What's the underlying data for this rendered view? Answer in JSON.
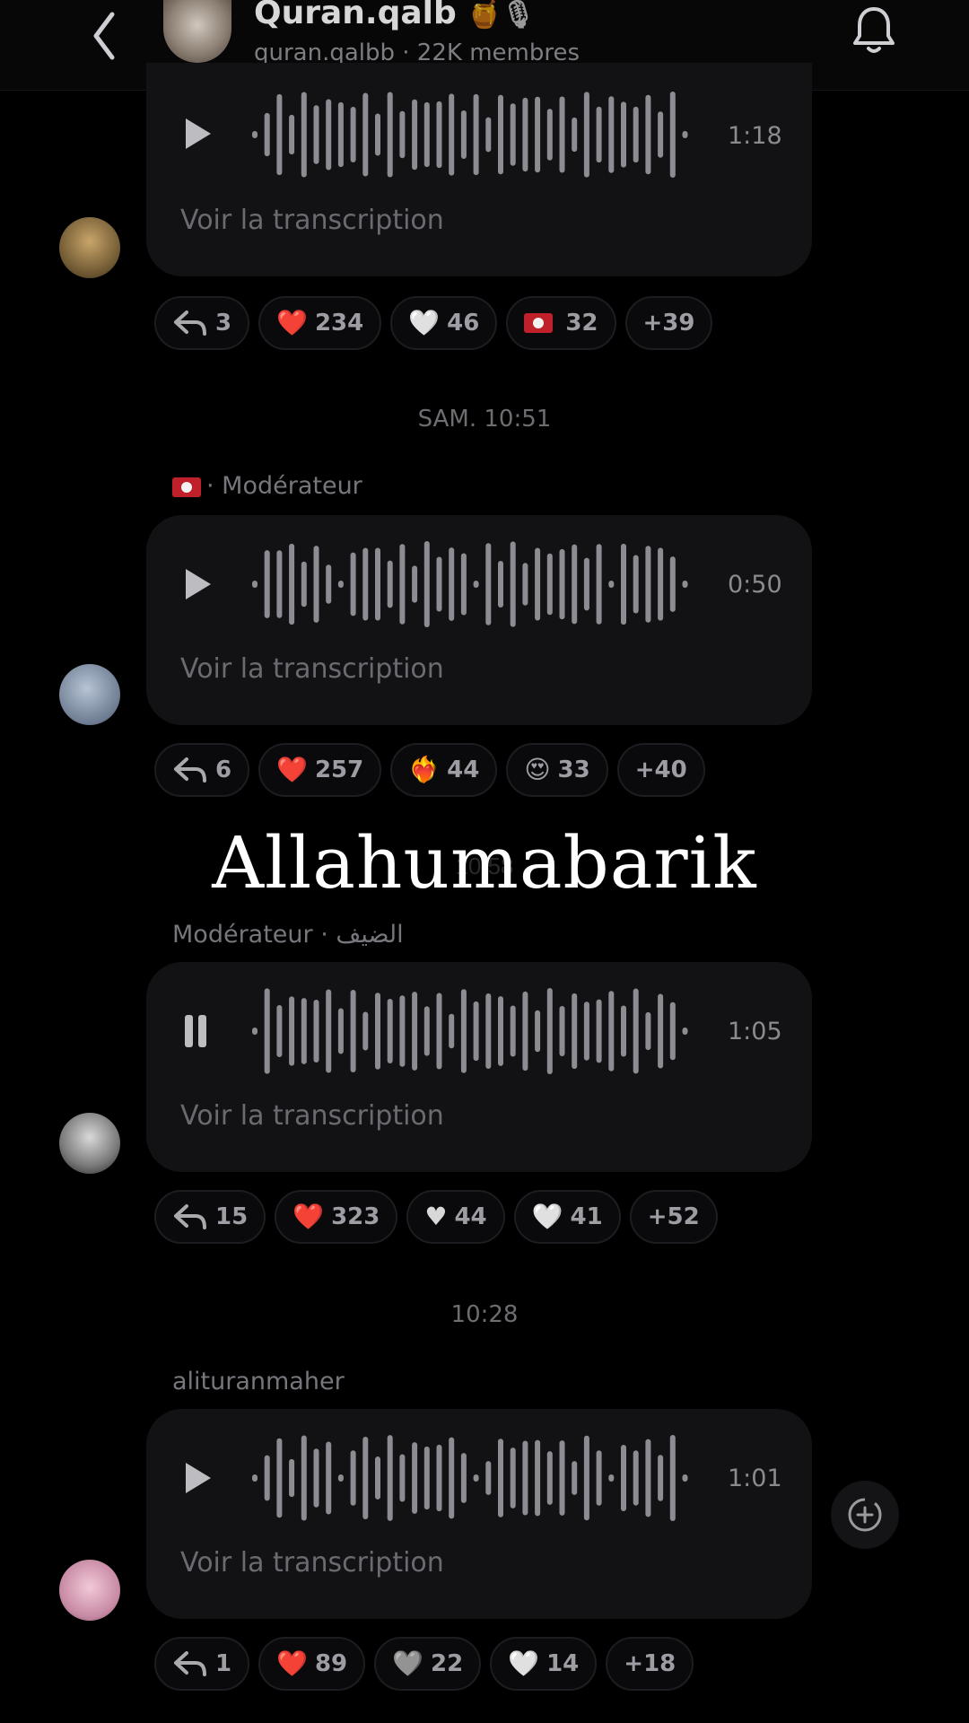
{
  "header": {
    "title": "Quran.qalb",
    "title_emojis": "🍯🎙",
    "handle": "quran.qalbb",
    "members": "· 22K membres"
  },
  "overlay_text": "Allahumabarik",
  "transcript_label": "Voir la transcription",
  "messages": [
    {
      "duration": "1:18",
      "reactions": {
        "reply": "3",
        "r1_emoji": "❤️",
        "r1": "234",
        "r2_emoji": "🤍",
        "r2": "46",
        "r3": "32",
        "more": "+39"
      }
    },
    {
      "time": "SAM. 10:51",
      "sender": "· Modérateur",
      "duration": "0:50",
      "reactions": {
        "reply": "6",
        "r1_emoji": "❤️",
        "r1": "257",
        "r2_emoji": "❤️‍🔥",
        "r2": "44",
        "r3_emoji": "😍",
        "r3": "33",
        "more": "+40"
      }
    },
    {
      "time": "10:58",
      "sender": "Modérateur · الضيف",
      "duration": "1:05",
      "reactions": {
        "reply": "15",
        "r1_emoji": "❤️",
        "r1": "323",
        "r2_emoji": "♥",
        "r2": "44",
        "r3_emoji": "🤍",
        "r3": "41",
        "more": "+52"
      }
    },
    {
      "time": "10:28",
      "sender": "alituranmaher",
      "duration": "1:01",
      "reactions": {
        "reply": "1",
        "r1_emoji": "❤️",
        "r1": "89",
        "r2_emoji": "🩶",
        "r2": "22",
        "r3_emoji": "🤍",
        "r3": "14",
        "more": "+18"
      }
    }
  ],
  "colors": {
    "background": "#000000",
    "bubble": "#121215",
    "wave": "#8c8c92",
    "chip_border": "#1d1d21"
  }
}
